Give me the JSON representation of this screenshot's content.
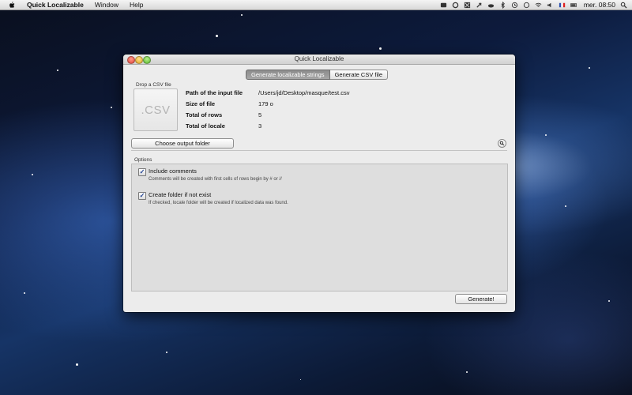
{
  "menubar": {
    "app_name": "Quick Localizable",
    "menus": [
      "Window",
      "Help"
    ],
    "clock": "mer. 08:50"
  },
  "window": {
    "title": "Quick Localizable",
    "tabs": [
      "Generate localizable strings",
      "Generate CSV file"
    ],
    "active_tab": 0
  },
  "drop": {
    "label": "Drop a CSV file",
    "placeholder": ".CSV"
  },
  "info": [
    {
      "label": "Path of the input file",
      "value": "/Users/jd/Desktop/masque/test.csv"
    },
    {
      "label": "Size of file",
      "value": "179 o"
    },
    {
      "label": "Total of rows",
      "value": "5"
    },
    {
      "label": "Total of locale",
      "value": "3"
    }
  ],
  "choose_output_label": "Choose output folder",
  "options": {
    "label": "Options",
    "items": [
      {
        "title": "Include comments",
        "description": "Comments will be created with first cells of rows begin by # or //",
        "checked": true
      },
      {
        "title": "Create folder if not exist",
        "description": "If checked, locale folder will be created if localized data was found.",
        "checked": true
      }
    ]
  },
  "generate_label": "Generate!"
}
